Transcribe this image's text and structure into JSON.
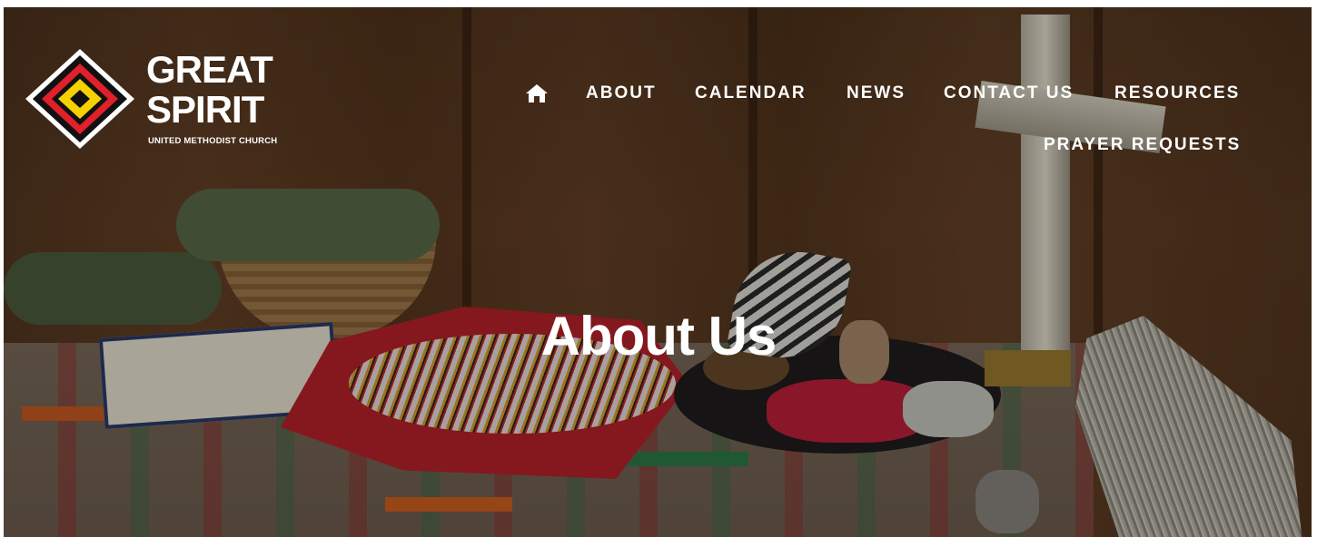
{
  "logo": {
    "line1": "GREAT",
    "line2": "SPIRIT",
    "subtitle": "UNITED METHODIST CHURCH",
    "colors": {
      "outer": "#111111",
      "red": "#e0202a",
      "yellow": "#f5d100",
      "white": "#ffffff"
    }
  },
  "nav": {
    "home_icon": "home-icon",
    "items": [
      {
        "label": "ABOUT"
      },
      {
        "label": "CALENDAR"
      },
      {
        "label": "NEWS"
      },
      {
        "label": "CONTACT US"
      },
      {
        "label": "RESOURCES"
      },
      {
        "label": "PRAYER REQUESTS"
      }
    ]
  },
  "hero": {
    "title": "About Us"
  }
}
